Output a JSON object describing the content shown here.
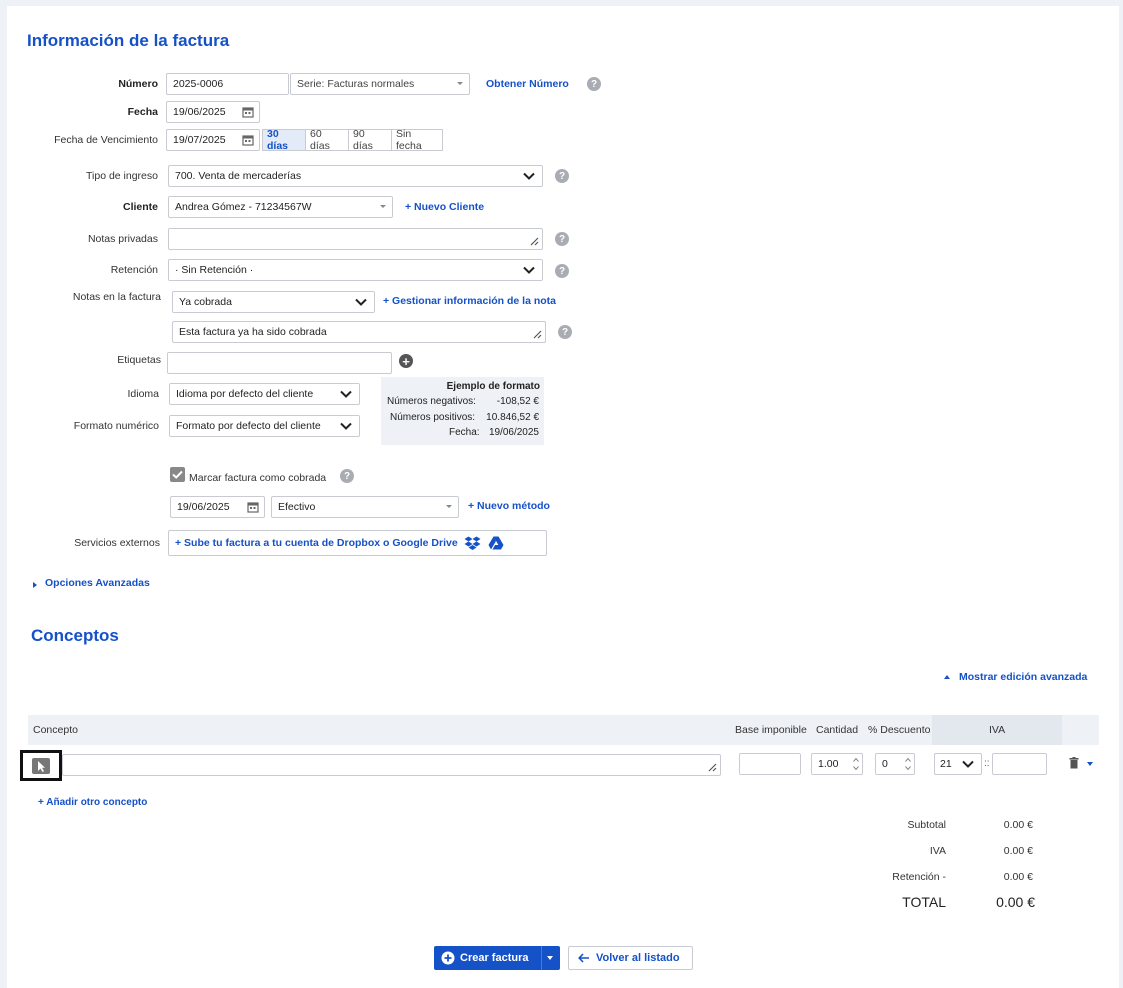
{
  "invoice": {
    "title": "Información de la factura",
    "numero": {
      "label": "Número",
      "value": "2025-0006",
      "serie": "Serie: Facturas normales",
      "obtener": "Obtener Número"
    },
    "fecha": {
      "label": "Fecha",
      "value": "19/06/2025"
    },
    "vencimiento": {
      "label": "Fecha de Vencimiento",
      "value": "19/07/2025",
      "options": [
        "30 días",
        "60 días",
        "90 días",
        "Sin fecha"
      ],
      "selected": "30 días"
    },
    "tipo_ingreso": {
      "label": "Tipo de ingreso",
      "value": "700. Venta de mercaderías"
    },
    "cliente": {
      "label": "Cliente",
      "value": "Andrea Gómez - 71234567W",
      "nuevo": "+ Nuevo Cliente"
    },
    "notas_privadas": {
      "label": "Notas privadas",
      "value": ""
    },
    "retencion": {
      "label": "Retención",
      "value": "· Sin Retención ·"
    },
    "notas_factura": {
      "label": "Notas en la factura",
      "select": "Ya cobrada",
      "gestionar": "+ Gestionar información de la nota",
      "text": "Esta factura ya ha sido cobrada"
    },
    "etiquetas": {
      "label": "Etiquetas",
      "value": ""
    },
    "idioma": {
      "label": "Idioma",
      "value": "Idioma por defecto del cliente"
    },
    "formato": {
      "label": "Formato numérico",
      "value": "Formato por defecto del cliente"
    },
    "ejemplo": {
      "title": "Ejemplo de formato",
      "rows": [
        {
          "k": "Números negativos:",
          "v": "-108,52 €"
        },
        {
          "k": "Números positivos:",
          "v": "10.846,52 €"
        },
        {
          "k": "Fecha:",
          "v": "19/06/2025"
        }
      ]
    },
    "cobrada": {
      "label": "Marcar factura como cobrada",
      "checked": true,
      "date": "19/06/2025",
      "method": "Efectivo",
      "nuevo": "+ Nuevo método"
    },
    "servicios": {
      "label": "Servicios externos",
      "link": "+ Sube tu factura a tu cuenta de Dropbox o Google Drive"
    },
    "avanzadas": "Opciones Avanzadas"
  },
  "conceptos": {
    "title": "Conceptos",
    "mostrar": "Mostrar edición avanzada",
    "headers": {
      "concepto": "Concepto",
      "base": "Base imponible",
      "cantidad": "Cantidad",
      "descuento": "% Descuento",
      "iva": "IVA"
    },
    "row": {
      "concepto": "",
      "base": "",
      "cantidad": "1.00",
      "descuento": "0",
      "iva": "21",
      "iva_sep": "::",
      "extra": ""
    },
    "anadir": "+ Añadir otro concepto"
  },
  "totals": {
    "rows": [
      {
        "k": "Subtotal",
        "v": "0.00 €"
      },
      {
        "k": "IVA",
        "v": "0.00 €"
      },
      {
        "k": "Retención -",
        "v": "0.00 €"
      }
    ],
    "total_label": "TOTAL",
    "total_value": "0.00 €"
  },
  "actions": {
    "crear": "Crear factura",
    "volver": "Volver al listado"
  },
  "colors": {
    "accent": "#1551c7",
    "panel": "#eef2f7"
  }
}
